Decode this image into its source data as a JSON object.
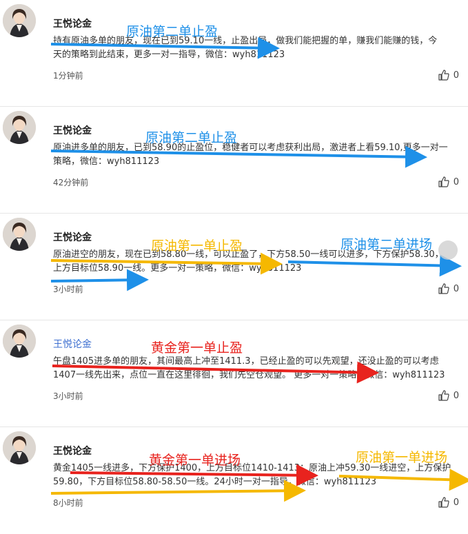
{
  "posts": [
    {
      "author": "王悦论金",
      "lines": [
        "持有原油多单的朋友，现在已到59.10一线，止盈出局，做我们能把握的单，赚我们能赚的钱，今",
        "天的策略到此结束，更多一对一指导，微信：wyh811123"
      ],
      "time": "1分钟前",
      "likes": "0"
    },
    {
      "author": "王悦论金",
      "lines": [
        "原油进多单的朋友，已到58.90的止盈位，稳健者可以考虑获利出局，激进者上看59.10,更多一对一",
        "策略，微信：wyh811123"
      ],
      "time": "42分钟前",
      "likes": "0"
    },
    {
      "author": "王悦论金",
      "lines": [
        "原油进空的朋友，现在已到58.80一线，可以止盈了，下方58.50一线可以进多，下方保护58.30，",
        "上方目标位58.90一线。更多一对一策略，微信：wyh811123"
      ],
      "time": "3小时前",
      "likes": "0"
    },
    {
      "author": "王悦论金",
      "lines": [
        "午盘1405进多单的朋友，其间最高上冲至1411.3，已经止盈的可以先观望，还没止盈的可以考虑",
        "1407一线先出来，点位一直在这里徘徊，我们先空仓观望。 更多一对一策略，微信：wyh811123"
      ],
      "time": "3小时前",
      "likes": "0"
    },
    {
      "author": "王悦论金",
      "lines": [
        "黄金1405一线进多，下方保护1400，上方目标位1410-1413；原油上冲59.30一线进空，上方保护",
        "59.80，下方目标位58.80-58.50一线。24小时一对一指导，微信：wyh811123"
      ],
      "time": "8小时前",
      "likes": "0"
    }
  ],
  "annotations": [
    {
      "text": "原油第二单止盈",
      "color": "#1e90e8"
    },
    {
      "text": "原油第二单止盈",
      "color": "#1e90e8"
    },
    {
      "text": "原油第一单止盈",
      "color": "#f5b800"
    },
    {
      "text": "原油第二单进场",
      "color": "#1e90e8"
    },
    {
      "text": "黄金第一单止盈",
      "color": "#e8231e"
    },
    {
      "text": "黄金第一单进场",
      "color": "#e8231e"
    },
    {
      "text": "原油第一单进场",
      "color": "#f5b800"
    }
  ]
}
